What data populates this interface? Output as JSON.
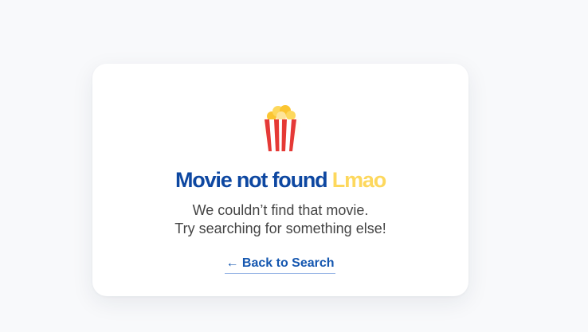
{
  "not_found": {
    "title_main": "Movie not found",
    "title_accent": "Lmao",
    "message_line1": "We couldn’t find that movie.",
    "message_line2": "Try searching for something else!",
    "back_link_label": "← Back to Search"
  },
  "icon": "popcorn-icon",
  "colors": {
    "background": "#f8f9fb",
    "card": "#ffffff",
    "title": "#0d47a1",
    "title_accent": "#fdd85d",
    "message": "#444444",
    "link": "#1557b0"
  }
}
